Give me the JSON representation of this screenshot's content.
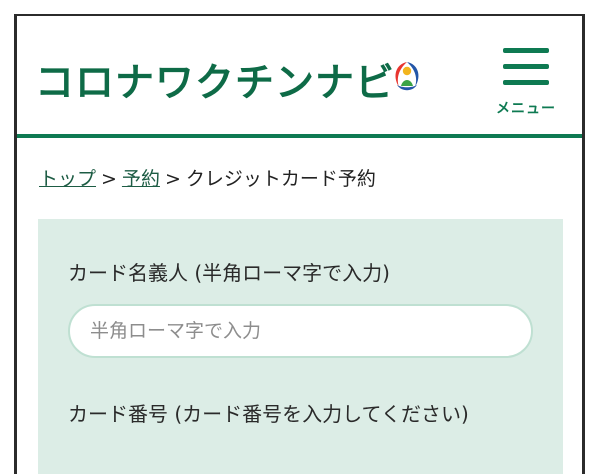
{
  "header": {
    "logo_text": "コロナワクチンナビ",
    "menu_label": "メニュー"
  },
  "breadcrumb": {
    "items": [
      {
        "label": "トップ"
      },
      {
        "label": "予約"
      },
      {
        "label": "クレジットカード予約"
      }
    ],
    "separator": ">"
  },
  "form": {
    "card_name": {
      "label": "カード名義人 (半角ローマ字で入力)",
      "placeholder": "半角ローマ字で入力",
      "value": ""
    },
    "card_number": {
      "label": "カード番号 (カード番号を入力してください)"
    }
  },
  "colors": {
    "brand_green": "#0e7a52",
    "form_bg": "#dcede6",
    "input_border": "#bfe0d2"
  },
  "icons": {
    "logo": "vaccine-navi-logo-icon",
    "menu": "hamburger-menu-icon"
  }
}
